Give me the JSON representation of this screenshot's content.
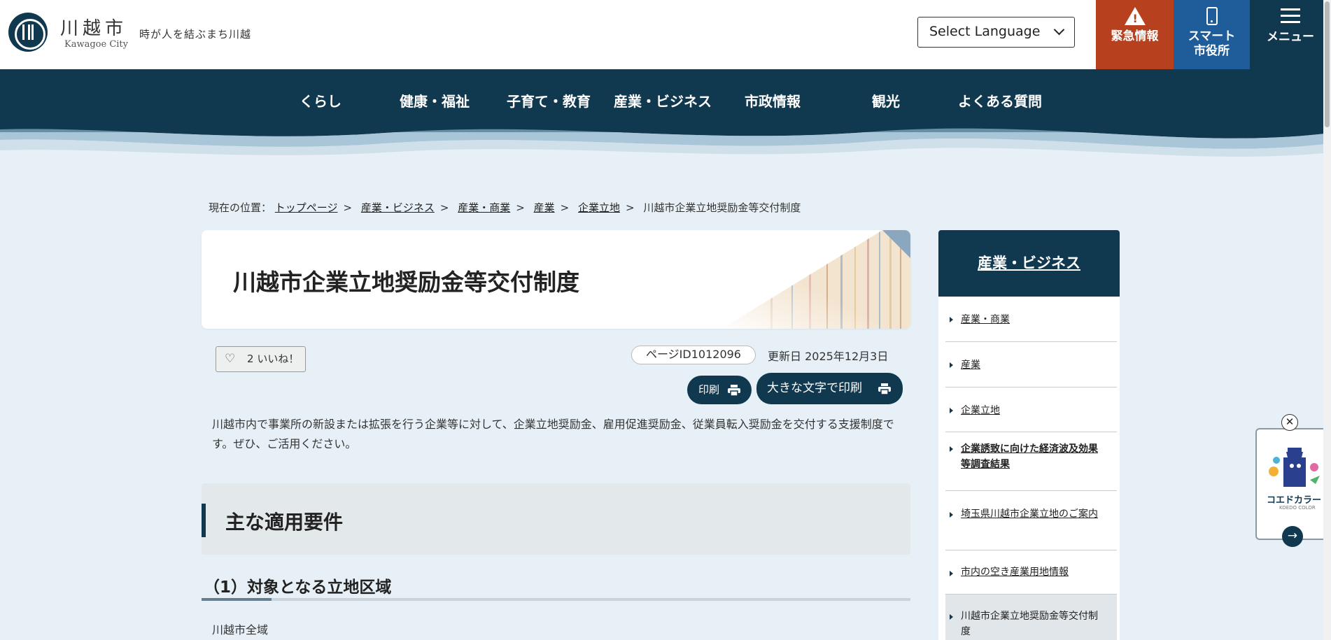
{
  "header": {
    "city_name": "川越市",
    "city_name_en": "Kawagoe City",
    "tagline": "時が人を結ぶまち川越",
    "language_select": "Select Language",
    "emergency_label": "緊急情報",
    "smart_line1": "スマート",
    "smart_line2": "市役所",
    "menu_label": "メニュー"
  },
  "nav": {
    "items": [
      "くらし",
      "健康・福祉",
      "子育て・教育",
      "産業・ビジネス",
      "市政情報",
      "観光",
      "よくある質問"
    ]
  },
  "breadcrumb": {
    "prefix": "現在の位置：",
    "links": [
      "トップページ",
      "産業・ビジネス",
      "産業・商業",
      "産業",
      "企業立地"
    ],
    "separator": ">",
    "current": "川越市企業立地奨励金等交付制度"
  },
  "page": {
    "title": "川越市企業立地奨励金等交付制度",
    "like_count": "2",
    "like_label": "いいね！",
    "page_id": "ページID1012096",
    "updated": "更新日 2025年12月3日",
    "print_label": "印刷",
    "print_large_label": "大きな文字で印刷",
    "lead": "川越市内で事業所の新設または拡張を行う企業等に対して、企業立地奨励金、雇用促進奨励金、従業員転入奨励金を交付する支援制度です。ぜひ、ご活用ください。",
    "h2": "主な適用要件",
    "h3": "（1）対象となる立地区域",
    "body": "川越市全域"
  },
  "sidebar": {
    "heading": "産業・ビジネス",
    "items": [
      {
        "label": "産業・商業"
      },
      {
        "label": "産業"
      },
      {
        "label": "企業立地"
      },
      {
        "label": "企業誘致に向けた経済波及効果等調査結果"
      },
      {
        "label": "埼玉県川越市企業立地のご案内"
      },
      {
        "label": "市内の空き産業用地情報"
      },
      {
        "label": "川越市企業立地奨励金等交付制度"
      }
    ]
  },
  "widget": {
    "close_label": "✕",
    "label": "コエドカラー",
    "sub": "KOEDO COLOR",
    "arrow": "→"
  },
  "colors": {
    "navy": "#10384f",
    "emergency": "#b7401e",
    "smart": "#1e5c9a",
    "background": "#e6f0f6"
  }
}
